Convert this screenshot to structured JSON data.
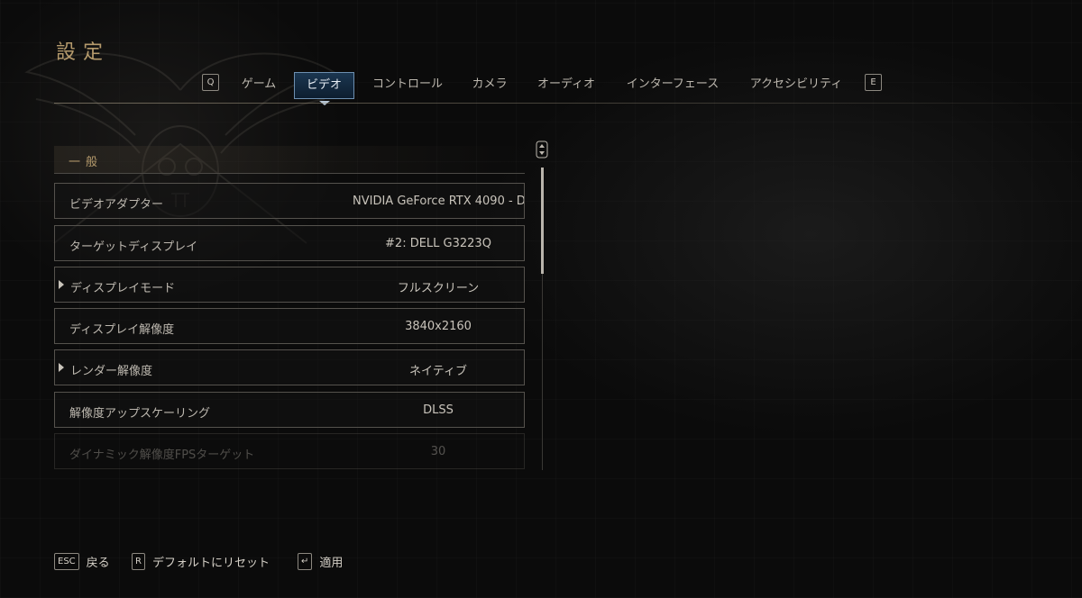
{
  "header": {
    "title": "設定"
  },
  "tabs": {
    "prev_key": "Q",
    "next_key": "E",
    "items": [
      {
        "label": "ゲーム"
      },
      {
        "label": "ビデオ"
      },
      {
        "label": "コントロール"
      },
      {
        "label": "カメラ"
      },
      {
        "label": "オーディオ"
      },
      {
        "label": "インターフェース"
      },
      {
        "label": "アクセシビリティ"
      }
    ],
    "active": "ビデオ"
  },
  "section": {
    "title": "一般"
  },
  "settings": [
    {
      "label": "ビデオアダプター",
      "value": "NVIDIA GeForce RTX 4090 - D",
      "expandable": false,
      "disabled": false
    },
    {
      "label": "ターゲットディスプレイ",
      "value": "#2: DELL G3223Q",
      "expandable": false,
      "disabled": false
    },
    {
      "label": "ディスプレイモード",
      "value": "フルスクリーン",
      "expandable": true,
      "disabled": false
    },
    {
      "label": "ディスプレイ解像度",
      "value": "3840x2160",
      "expandable": false,
      "disabled": false
    },
    {
      "label": "レンダー解像度",
      "value": "ネイティブ",
      "expandable": true,
      "disabled": false
    },
    {
      "label": "解像度アップスケーリング",
      "value": "DLSS",
      "expandable": false,
      "disabled": false
    },
    {
      "label": "ダイナミック解像度FPSターゲット",
      "value": "30",
      "expandable": false,
      "disabled": true
    }
  ],
  "footer": {
    "back_key": "ESC",
    "back_label": "戻る",
    "reset_key": "R",
    "reset_label": "デフォルトにリセット",
    "apply_key": "↵",
    "apply_label": "適用"
  },
  "colors": {
    "accent_gold": "#b59a6c",
    "active_tab": "#1b3650"
  }
}
